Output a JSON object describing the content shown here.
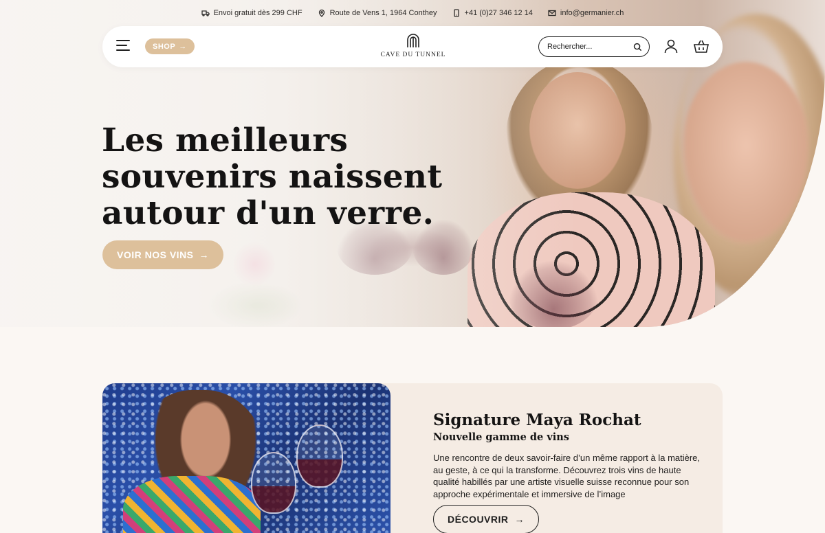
{
  "topbar": {
    "shipping": "Envoi gratuit dès 299 CHF",
    "address": "Route de Vens 1, 1964 Conthey",
    "phone": "+41 (0)27 346 12 14",
    "email": "info@germanier.ch"
  },
  "header": {
    "shop_label": "SHOP",
    "logo_text": "CAVE DU TUNNEL",
    "search_placeholder": "Rechercher..."
  },
  "hero": {
    "title_line1": "Les meilleurs",
    "title_line2": "souvenirs naissent",
    "title_line3": "autour d'un verre.",
    "cta_label": "VOIR NOS VINS"
  },
  "feature": {
    "title": "Signature Maya Rochat",
    "subtitle": "Nouvelle gamme de vins",
    "body": "Une rencontre de deux savoir-faire d’un même rapport à la matière, au geste, à ce qui la transforme. Découvrez trois vins de haute qualité habillés par une artiste visuelle suisse reconnue pour son approche expérimentale et immersive de l’image",
    "cta_label": "DÉCOUVRIR"
  },
  "colors": {
    "accent": "#ddc09b",
    "background": "#fbf7f3",
    "card": "#f5ece4",
    "text": "#141313"
  },
  "icons": {
    "shipping": "truck-icon",
    "address": "map-pin-icon",
    "phone": "phone-icon",
    "email": "mail-icon",
    "menu": "hamburger-icon",
    "search": "search-icon",
    "account": "user-icon",
    "cart": "basket-icon",
    "arrow": "arrow-right-icon"
  }
}
